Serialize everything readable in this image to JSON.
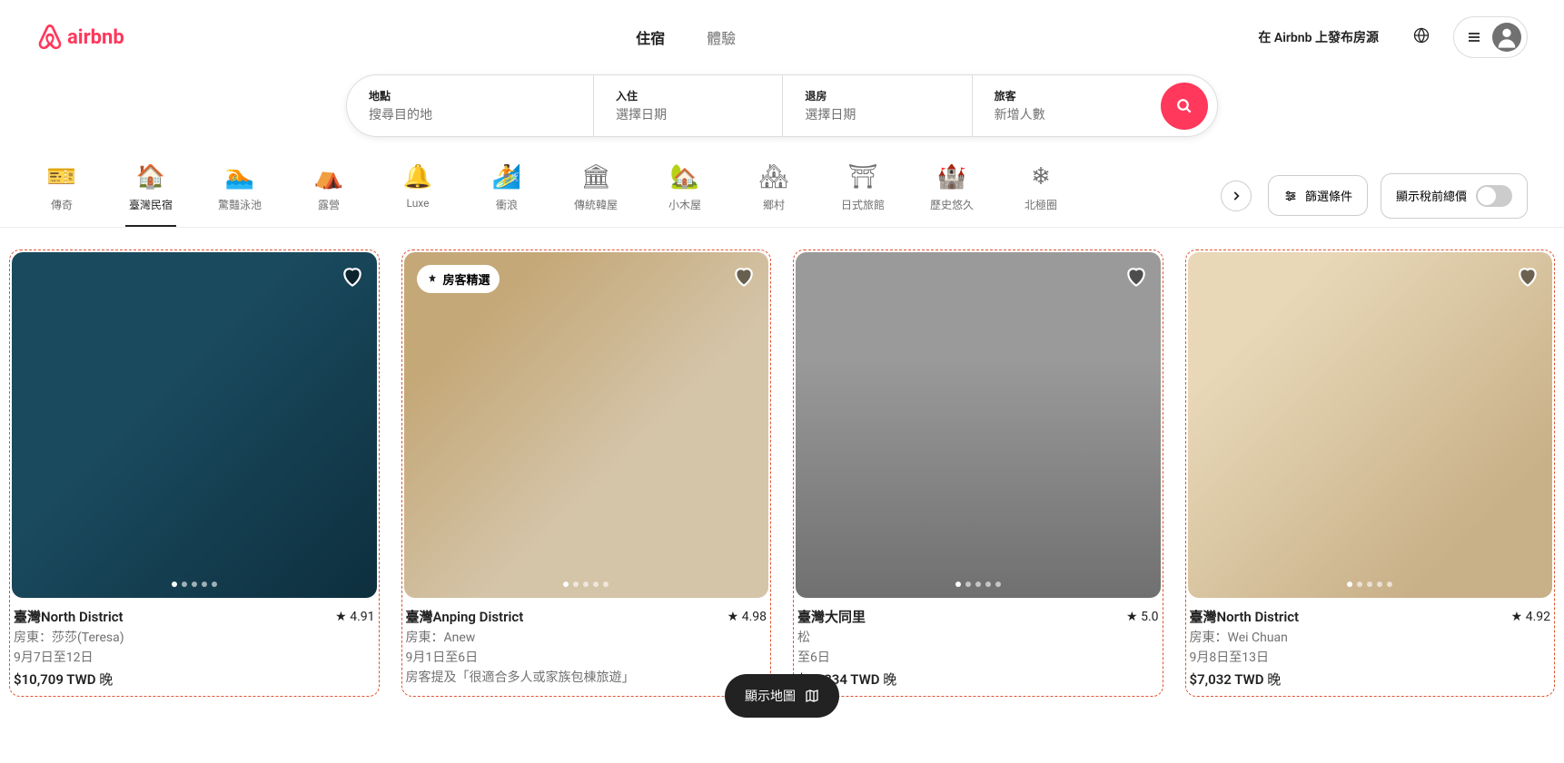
{
  "header": {
    "logo_text": "airbnb",
    "nav": {
      "stays": "住宿",
      "experiences": "體驗"
    },
    "host_link": "在 Airbnb 上發布房源"
  },
  "search": {
    "where_label": "地點",
    "where_placeholder": "搜尋目的地",
    "checkin_label": "入住",
    "checkin_placeholder": "選擇日期",
    "checkout_label": "退房",
    "checkout_placeholder": "選擇日期",
    "who_label": "旅客",
    "who_placeholder": "新增人數"
  },
  "categories": [
    {
      "label": "傳奇",
      "icon": "🎫"
    },
    {
      "label": "臺灣民宿",
      "icon": "🏠",
      "active": true
    },
    {
      "label": "驚豔泳池",
      "icon": "🏊"
    },
    {
      "label": "露營",
      "icon": "⛺"
    },
    {
      "label": "Luxe",
      "icon": "🔔"
    },
    {
      "label": "衝浪",
      "icon": "🏄"
    },
    {
      "label": "傳統韓屋",
      "icon": "🏛"
    },
    {
      "label": "小木屋",
      "icon": "🏡"
    },
    {
      "label": "鄉村",
      "icon": "🏘"
    },
    {
      "label": "日式旅館",
      "icon": "⛩"
    },
    {
      "label": "歷史悠久",
      "icon": "🏰"
    },
    {
      "label": "北極圈",
      "icon": "❄"
    }
  ],
  "filters_label": "篩選條件",
  "tax_toggle_label": "顯示稅前總價",
  "listings": [
    {
      "title": "臺灣North District",
      "rating": "4.91",
      "host": "房東：莎莎(Teresa)",
      "dates": "9月7日至12日",
      "note": "",
      "price_value": "$10,709 TWD",
      "price_suffix": " 晚",
      "badge": ""
    },
    {
      "title": "臺灣Anping District",
      "rating": "4.98",
      "host": "房東：Anew",
      "dates": "9月1日至6日",
      "note": "房客提及「很適合多人或家族包棟旅遊」",
      "price_value": "",
      "price_suffix": "",
      "badge": "房客精選"
    },
    {
      "title": "臺灣大同里",
      "rating": "5.0",
      "host": "松",
      "dates": "至6日",
      "note": "",
      "price_value": "$10,334 TWD",
      "price_suffix": " 晚",
      "badge": ""
    },
    {
      "title": "臺灣North District",
      "rating": "4.92",
      "host": "房東：Wei Chuan",
      "dates": "9月8日至13日",
      "note": "",
      "price_value": "$7,032 TWD",
      "price_suffix": " 晚",
      "badge": ""
    }
  ],
  "map_button": "顯示地圖"
}
